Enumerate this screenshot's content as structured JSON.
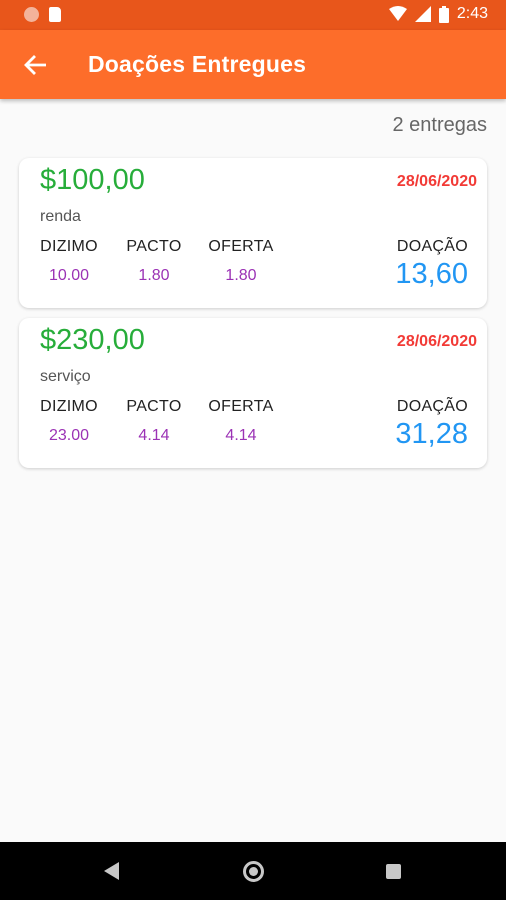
{
  "status_bar": {
    "time": "2:43"
  },
  "app_bar": {
    "title": "Doações Entregues"
  },
  "summary": {
    "count_text": "2 entregas"
  },
  "labels": {
    "dizimo": "DIZIMO",
    "pacto": "PACTO",
    "oferta": "OFERTA",
    "doacao": "DOAÇÃO"
  },
  "donations": [
    {
      "amount": "$100,00",
      "date": "28/06/2020",
      "category": "renda",
      "dizimo": "10.00",
      "pacto": "1.80",
      "oferta": "1.80",
      "doacao": "13,60"
    },
    {
      "amount": "$230,00",
      "date": "28/06/2020",
      "category": "serviço",
      "dizimo": "23.00",
      "pacto": "4.14",
      "oferta": "4.14",
      "doacao": "31,28"
    }
  ],
  "colors": {
    "app_bar": "#fd6d2a",
    "status_bar": "#e8561b",
    "amount": "#27ad3a",
    "date": "#f23a36",
    "percentages": "#9b32b5",
    "donation": "#2196f3"
  }
}
